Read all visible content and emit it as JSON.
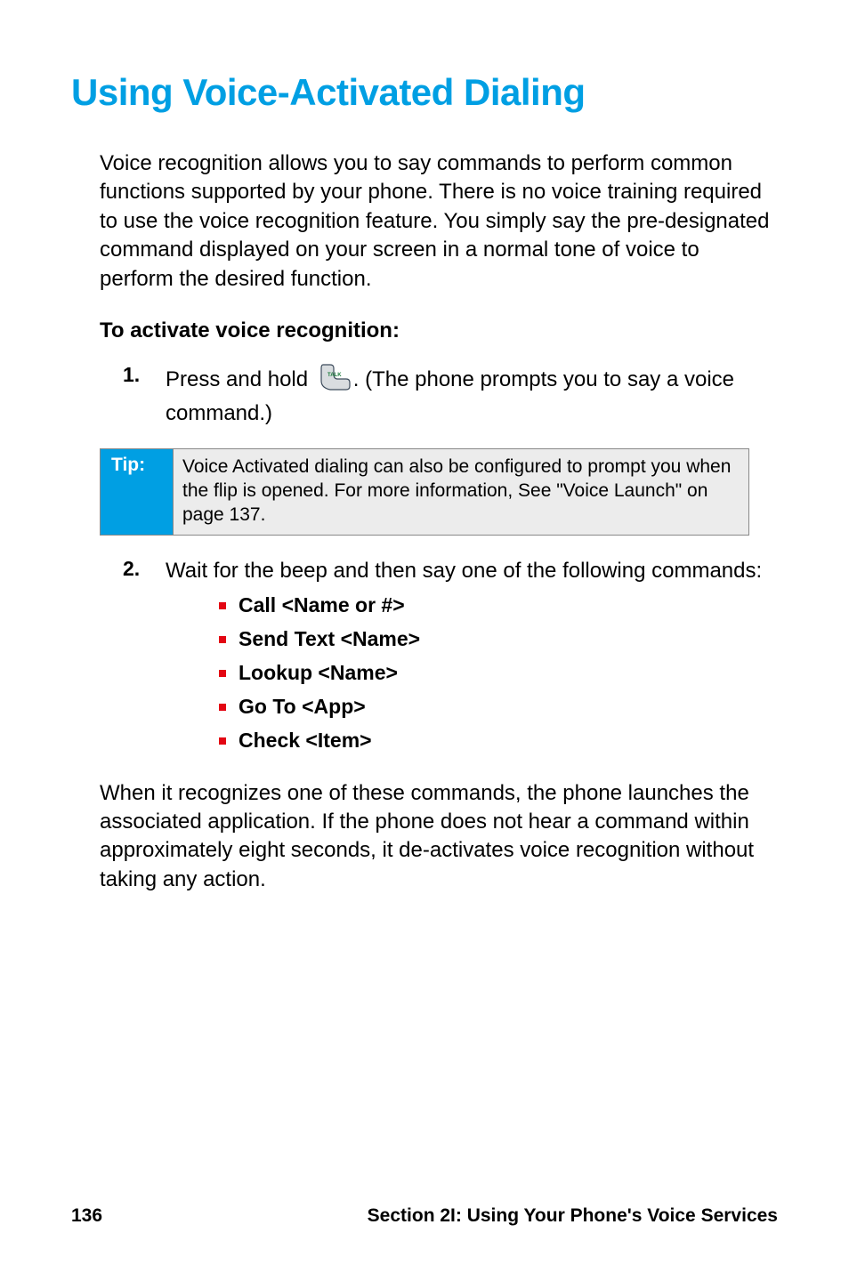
{
  "title": "Using Voice-Activated Dialing",
  "intro": "Voice recognition allows you to say commands to perform common functions supported by your phone. There is no voice training required to use the voice recognition feature. You simply say the pre-designated command displayed on your screen in a normal tone of voice to perform the desired function.",
  "subhead": "To activate voice recognition:",
  "step1_num": "1.",
  "step1_before": "Press and hold ",
  "step1_after": ". (The phone prompts you to say a voice command.)",
  "talk_icon_name": "talk-key-icon",
  "tip": {
    "label": "Tip:",
    "text": "Voice Activated dialing can also be configured to prompt you when the flip is opened. For more information, See \"Voice Launch\" on page 137."
  },
  "step2_num": "2.",
  "step2_text": "Wait for the beep and then say one of the following commands:",
  "commands": [
    "Call <Name or #>",
    "Send Text <Name>",
    "Lookup <Name>",
    "Go To <App>",
    "Check <Item>"
  ],
  "closing": "When it recognizes one of these commands, the phone launches the associated application. If the phone does not hear a command within approximately eight seconds, it de-activates voice recognition without taking any action.",
  "footer": {
    "page": "136",
    "section": "Section 2I: Using Your Phone's Voice Services"
  }
}
